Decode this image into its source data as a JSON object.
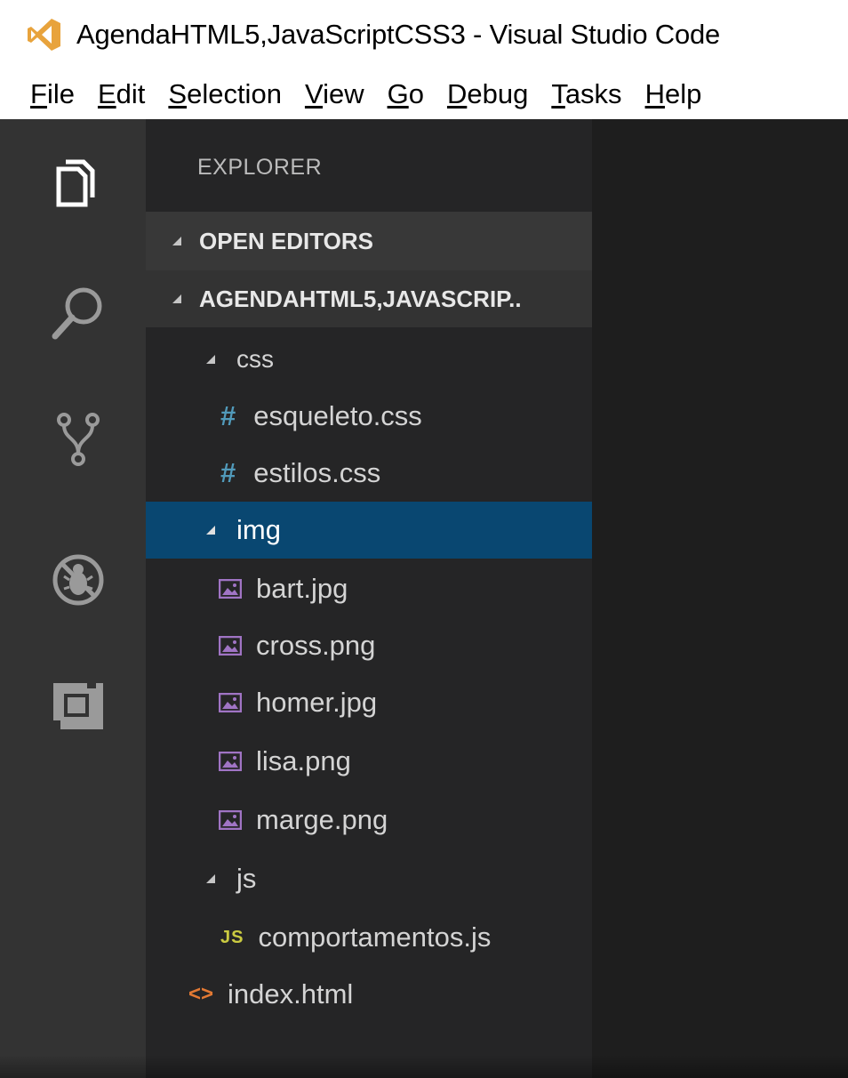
{
  "window": {
    "title": "AgendaHTML5,JavaScriptCSS3 - Visual Studio Code"
  },
  "menu": [
    {
      "mnemonic": "F",
      "rest": "ile"
    },
    {
      "mnemonic": "E",
      "rest": "dit"
    },
    {
      "mnemonic": "S",
      "rest": "election"
    },
    {
      "mnemonic": "V",
      "rest": "iew"
    },
    {
      "mnemonic": "G",
      "rest": "o"
    },
    {
      "mnemonic": "D",
      "rest": "ebug"
    },
    {
      "mnemonic": "T",
      "rest": "asks"
    },
    {
      "mnemonic": "H",
      "rest": "elp"
    }
  ],
  "activity_bar": [
    "files-icon",
    "search-icon",
    "source-control-icon",
    "debug-icon",
    "extensions-icon"
  ],
  "explorer": {
    "title": "EXPLORER",
    "sections": {
      "open_editors": "OPEN EDITORS",
      "project": "AGENDAHTML5,JAVASCRIP.."
    },
    "tree": [
      {
        "label": "css",
        "kind": "folder"
      },
      {
        "label": "esqueleto.css",
        "kind": "css",
        "badge": "#"
      },
      {
        "label": "estilos.css",
        "kind": "css",
        "badge": "#"
      },
      {
        "label": "img",
        "kind": "folder",
        "selected": true
      },
      {
        "label": "bart.jpg",
        "kind": "image"
      },
      {
        "label": "cross.png",
        "kind": "image"
      },
      {
        "label": "homer.jpg",
        "kind": "image"
      },
      {
        "label": "lisa.png",
        "kind": "image"
      },
      {
        "label": "marge.png",
        "kind": "image"
      },
      {
        "label": "js",
        "kind": "folder"
      },
      {
        "label": "comportamentos.js",
        "kind": "js",
        "badge": "JS"
      },
      {
        "label": "index.html",
        "kind": "html",
        "badge": "<>"
      }
    ]
  },
  "colors": {
    "activity_bar": "#333333",
    "sidebar": "#252526",
    "section_header": "#383838",
    "selection": "#094771",
    "editor": "#1e1e1e",
    "css_icon": "#519aba",
    "image_icon": "#a074c4",
    "js_icon": "#cbcb41",
    "html_icon": "#e37933"
  }
}
